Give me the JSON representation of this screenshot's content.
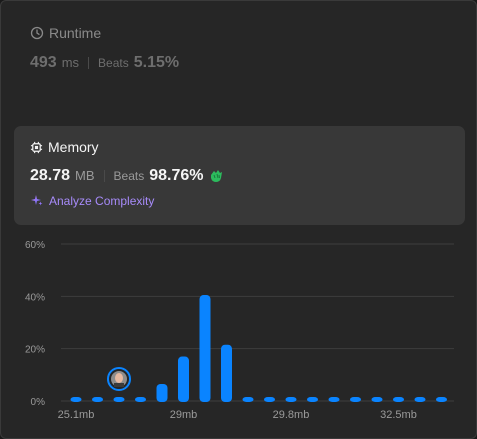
{
  "runtime": {
    "title": "Runtime",
    "value": "493",
    "unit": "ms",
    "beats_label": "Beats",
    "beats_value": "5.15%"
  },
  "memory": {
    "title": "Memory",
    "value": "28.78",
    "unit": "MB",
    "beats_label": "Beats",
    "beats_value": "98.76%",
    "analyze_label": "Analyze Complexity"
  },
  "colors": {
    "bar": "#0a84ff",
    "grid": "#3e3e3e",
    "axis_text": "#9a9a9a",
    "accent_purple": "#a78bfa",
    "clap_green": "#2cbb5d"
  },
  "icons": {
    "runtime": "clock-icon",
    "memory": "chip-icon",
    "analyze": "sparkle-icon",
    "beats": "clap-icon"
  },
  "chart_data": {
    "type": "bar",
    "y_ticks": [
      "60%",
      "40%",
      "20%",
      "0%"
    ],
    "ylim": [
      0,
      60
    ],
    "x_tick_labels": [
      "25.1mb",
      "29mb",
      "29.8mb",
      "32.5mb"
    ],
    "x_tick_positions": [
      0,
      5,
      10,
      15
    ],
    "values": [
      1.2,
      1.2,
      1.2,
      1.2,
      6.5,
      17,
      40.5,
      21.5,
      1.2,
      1.2,
      1.2,
      1.2,
      1.2,
      1.2,
      1.2,
      1.2,
      1.2,
      1.2
    ],
    "marker_index": 2,
    "grid": true
  }
}
